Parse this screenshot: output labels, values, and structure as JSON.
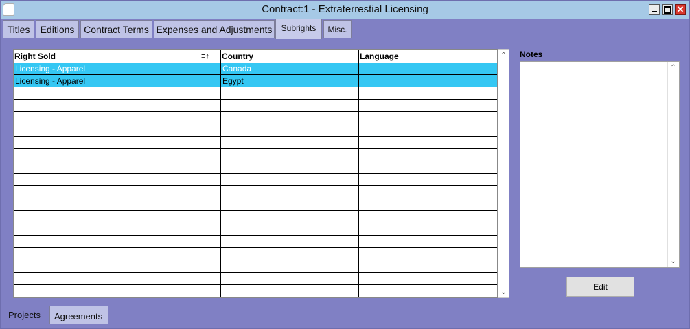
{
  "window": {
    "title": "Contract:1 - Extraterrestial Licensing",
    "close_glyph": "✕"
  },
  "tabs": [
    {
      "label": "Titles"
    },
    {
      "label": "Editions"
    },
    {
      "label": "Contract Terms"
    },
    {
      "label": "Expenses and Adjustments"
    },
    {
      "label": "Subrights",
      "active": true
    },
    {
      "label": "Misc."
    }
  ],
  "grid": {
    "columns": [
      "Right Sold",
      "Country",
      "Language"
    ],
    "sort_glyph": "≡↑",
    "rows": [
      {
        "right_sold": "Licensing - Apparel",
        "country": "Canada",
        "language": ""
      },
      {
        "right_sold": "Licensing - Apparel",
        "country": "Egypt",
        "language": ""
      }
    ],
    "empty_rows": 17,
    "scroll_up_glyph": "⌃",
    "scroll_down_glyph": "⌄"
  },
  "notes": {
    "label": "Notes",
    "value": ""
  },
  "edit_button": {
    "label": "Edit"
  },
  "bottom_tabs": [
    {
      "label": "Projects",
      "active": true
    },
    {
      "label": "Agreements"
    }
  ],
  "colors": {
    "background": "#8080c4",
    "titlebar": "#a6c9e6",
    "selection": "#35c7f3",
    "tab": "#bfc3e6"
  }
}
